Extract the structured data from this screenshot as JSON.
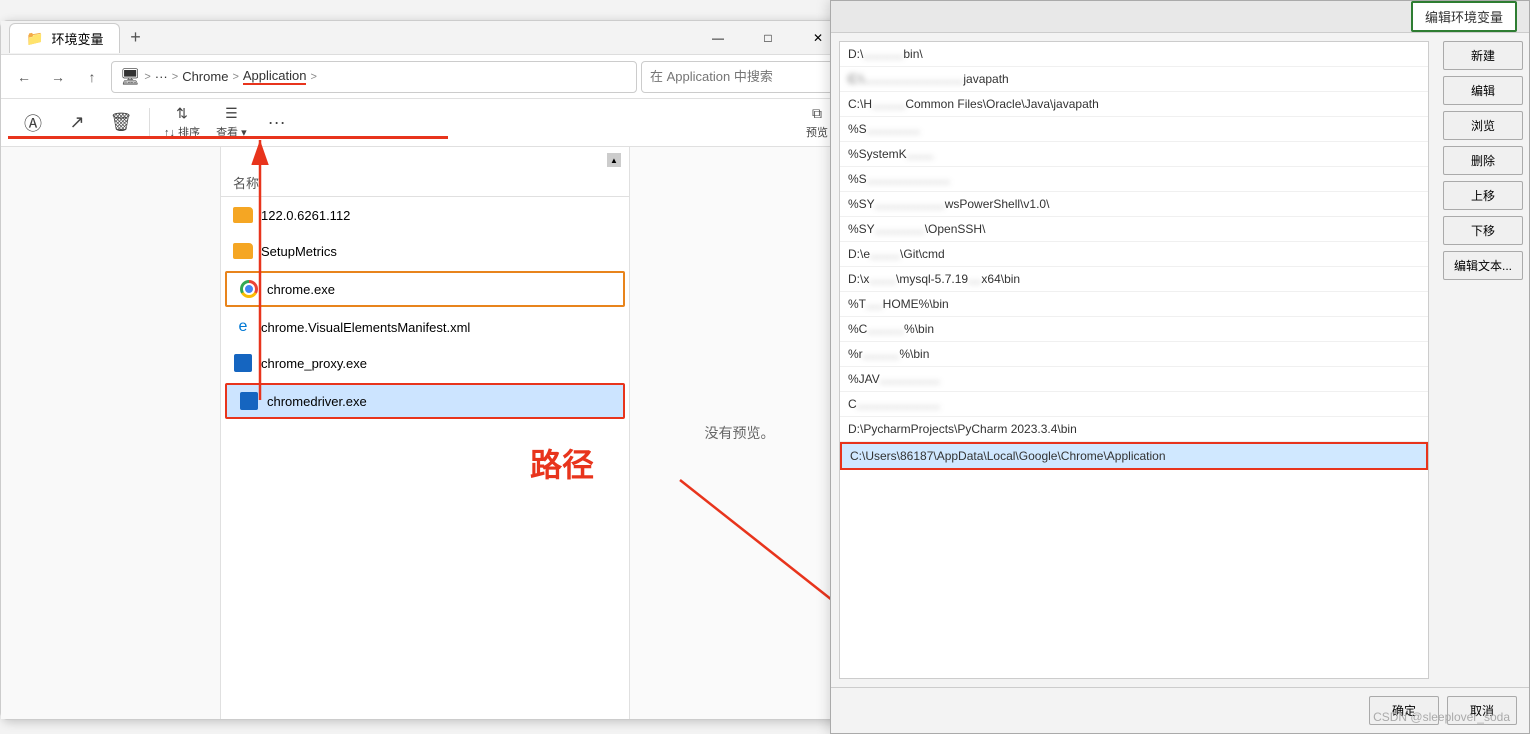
{
  "explorer": {
    "title": "环境变量",
    "tab_label": "环境变量",
    "new_tab": "+",
    "nav": {
      "back": "←",
      "forward": "→",
      "more": "···",
      "breadcrumb": [
        "",
        ">",
        "···",
        "Chrome",
        ">",
        "Application",
        ">"
      ],
      "search_placeholder": "在 Application 中搜索"
    },
    "toolbar": {
      "rename": "重命名",
      "share": "共享",
      "delete": "删除",
      "sort": "↑↓ 排序",
      "view": "≡ 查看",
      "more": "···",
      "preview": "预览"
    },
    "column": {
      "name": "名称"
    },
    "files": [
      {
        "name": "122.0.6261.112",
        "type": "folder",
        "selected": false,
        "orange": false,
        "red": false
      },
      {
        "name": "SetupMetrics",
        "type": "folder",
        "selected": false,
        "orange": false,
        "red": false
      },
      {
        "name": "chrome.exe",
        "type": "chrome",
        "selected": false,
        "orange": true,
        "red": false
      },
      {
        "name": "chrome.VisualElementsManifest.xml",
        "type": "xml",
        "selected": false,
        "orange": false,
        "red": false
      },
      {
        "name": "chrome_proxy.exe",
        "type": "exe",
        "selected": false,
        "orange": false,
        "red": false
      },
      {
        "name": "chromedriver.exe",
        "type": "exe-blue",
        "selected": true,
        "orange": false,
        "red": true
      }
    ],
    "preview": "没有预览。",
    "scroll_up": "▲"
  },
  "annotation": {
    "label": "路径"
  },
  "env_dialog": {
    "title": "编辑环境变量",
    "highlight_btn": "编辑环境变量",
    "items": [
      {
        "text": "D:\\..........bin\\",
        "blurred": false
      },
      {
        "text": "C:\\................javapath",
        "blurred": true
      },
      {
        "text": "C:\\H...........Common Files\\Oracle\\Java\\javapath",
        "blurred": true
      },
      {
        "text": "%S.........t%.......1",
        "blurred": true
      },
      {
        "text": "%SystemK...",
        "blurred": true
      },
      {
        "text": "%S.......................",
        "blurred": true
      },
      {
        "text": "%SY.................wsPowerShell\\v1.0\\",
        "blurred": true
      },
      {
        "text": "%SY...............\\OpenSSH\\",
        "blurred": true
      },
      {
        "text": "D:\\e...........\\Git\\cmd",
        "blurred": true
      },
      {
        "text": "D:\\x...........\\mysql-5.7.19....x64\\bin",
        "blurred": true
      },
      {
        "text": "%T......HOME%\\bin",
        "blurred": true
      },
      {
        "text": "%C.............%\\bin",
        "blurred": true
      },
      {
        "text": "%r..............%\\bin",
        "blurred": true
      },
      {
        "text": "%JAV.................)",
        "blurred": true
      },
      {
        "text": "C.....................",
        "blurred": true
      },
      {
        "text": "D:\\PycharmProjects\\PyCharm 2023.3.4\\bin",
        "blurred": false
      },
      {
        "text": "C:\\Users\\86187\\AppData\\Local\\Google\\Chrome\\Application",
        "blurred": false,
        "highlighted": true
      }
    ],
    "buttons": [
      "新建",
      "编辑",
      "浏览",
      "删除",
      "上移",
      "下移",
      "编辑文本..."
    ]
  },
  "watermark": "CSDN @sleeplover_soda"
}
